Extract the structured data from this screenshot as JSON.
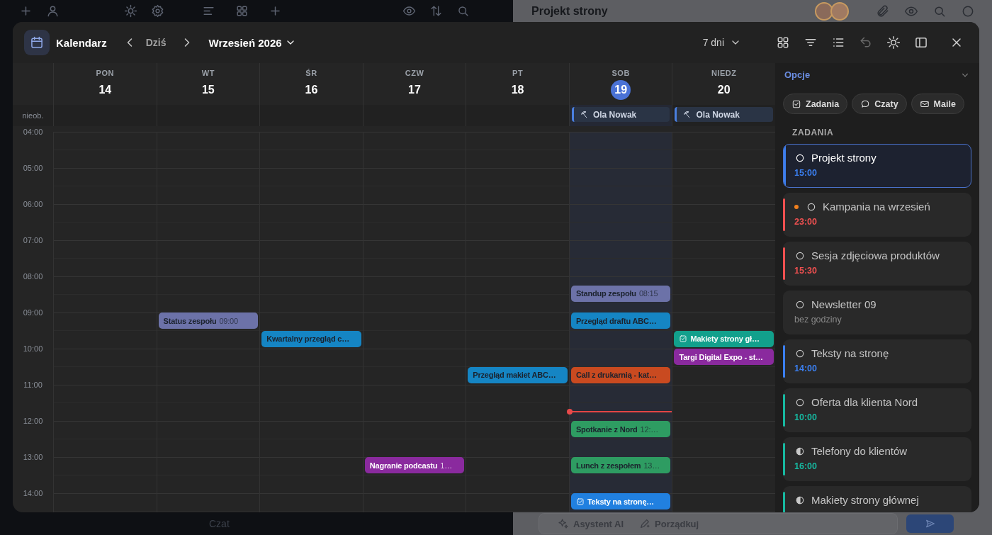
{
  "app": {
    "right_title": "Projekt strony",
    "chat_label": "Czat",
    "composer_actions": [
      {
        "label": "Asystent AI",
        "kind": "ai"
      },
      {
        "label": "Porządkuj",
        "kind": "tidy"
      }
    ]
  },
  "calendar": {
    "title": "Kalendarz",
    "today_button": "Dziś",
    "month": "Wrzesień 2026",
    "range": "7 dni",
    "allday_label": "nieob.",
    "hours": [
      "04:00",
      "05:00",
      "06:00",
      "07:00",
      "08:00",
      "09:00",
      "10:00",
      "11:00",
      "12:00",
      "13:00",
      "14:00"
    ],
    "days": [
      {
        "weekday": "PON",
        "date": "14",
        "today": false,
        "now_line": false
      },
      {
        "weekday": "WT",
        "date": "15",
        "today": false,
        "now_line": false,
        "events": [
          {
            "kind": "event",
            "title": "Status zespołu",
            "time": "09:00",
            "color": "#6c72a8"
          }
        ]
      },
      {
        "weekday": "ŚR",
        "date": "16",
        "today": false,
        "now_line": false,
        "events": [
          {
            "kind": "event",
            "title": "Kwartalny przegląd c…",
            "color": "#1585c4"
          }
        ]
      },
      {
        "weekday": "CZW",
        "date": "17",
        "today": false,
        "now_line": false,
        "events": [
          {
            "kind": "event",
            "title": "Nagranie podcastu",
            "time": "1…",
            "color": "#8a2a9e"
          }
        ]
      },
      {
        "weekday": "PT",
        "date": "18",
        "today": false,
        "now_line": false,
        "events": [
          {
            "kind": "event",
            "title": "Przegląd makiet ABC…",
            "color": "#1585c4"
          }
        ]
      },
      {
        "weekday": "SOB",
        "date": "19",
        "today": true,
        "now_line": true,
        "absence": "Ola Nowak",
        "events": [
          {
            "kind": "event",
            "title": "Standup zespołu",
            "time": "08:15",
            "color": "#6c72a8"
          },
          {
            "kind": "event",
            "title": "Przegląd draftu ABC…",
            "color": "#1585c4"
          },
          {
            "kind": "event",
            "title": "Call z drukarnią - kat…",
            "color": "#c94a20"
          },
          {
            "kind": "event",
            "title": "Spotkanie z Nord",
            "time": "12:…",
            "color": "#2e9c62"
          },
          {
            "kind": "event",
            "title": "Lunch z zespołem",
            "time": "13…",
            "color": "#2e9c62"
          },
          {
            "kind": "task",
            "title": "Teksty na stronę…",
            "color": "#2180e0"
          }
        ]
      },
      {
        "weekday": "NIEDZ",
        "date": "20",
        "today": false,
        "now_line": false,
        "absence": "Ola Nowak",
        "events": [
          {
            "kind": "task",
            "title": "Makiety strony gł…",
            "color": "#12a08c"
          },
          {
            "kind": "event",
            "title": "Targi Digital Expo - st…",
            "color": "#8a2a9e"
          }
        ]
      }
    ]
  },
  "panel": {
    "title": "Opcje",
    "section": "ZADANIA",
    "filters": [
      {
        "label": "Zadania",
        "kind": "tasks"
      },
      {
        "label": "Czaty",
        "kind": "chats"
      },
      {
        "label": "Maile",
        "kind": "mail"
      }
    ],
    "tasks": [
      {
        "title": "Projekt strony",
        "time": "15:00",
        "color": "#3b7ff0",
        "in_progress": false,
        "urgent": false,
        "selected": true
      },
      {
        "title": "Kampania na wrzesień",
        "time": "23:00",
        "color": "#ef5050",
        "in_progress": false,
        "urgent": true,
        "selected": false
      },
      {
        "title": "Sesja zdjęciowa produktów",
        "time": "15:30",
        "color": "#ef5050",
        "in_progress": false,
        "urgent": false,
        "selected": false
      },
      {
        "title": "Newsletter 09",
        "time": "bez godziny",
        "in_progress": false,
        "urgent": false,
        "selected": false
      },
      {
        "title": "Teksty na stronę",
        "time": "14:00",
        "color": "#3b7ff0",
        "in_progress": false,
        "urgent": false,
        "selected": false
      },
      {
        "title": "Oferta dla klienta Nord",
        "time": "10:00",
        "color": "#17b8a0",
        "in_progress": false,
        "urgent": false,
        "selected": false
      },
      {
        "title": "Telefony do klientów",
        "time": "16:00",
        "color": "#17b8a0",
        "in_progress": true,
        "urgent": false,
        "selected": false
      },
      {
        "title": "Makiety strony głównej",
        "color": "#17b8a0",
        "in_progress": true,
        "urgent": false,
        "selected": false
      }
    ]
  }
}
